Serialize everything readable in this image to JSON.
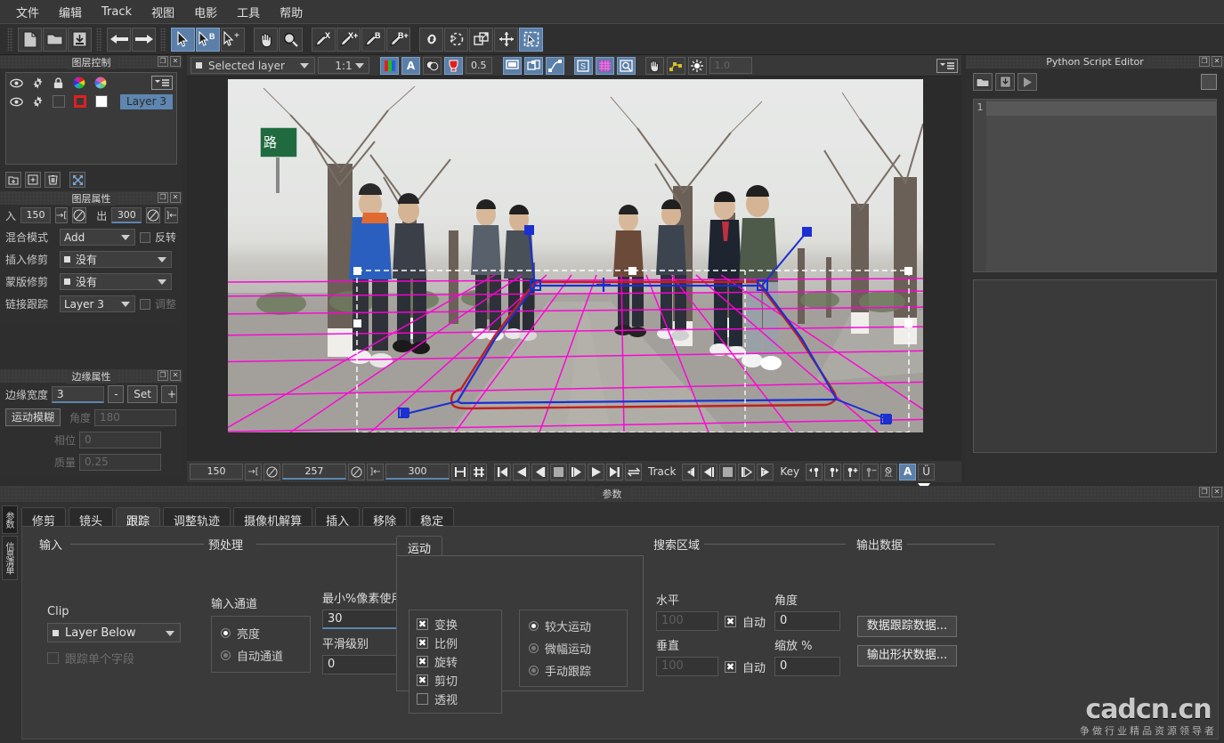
{
  "app": {
    "menu": [
      "文件",
      "编辑",
      "Track",
      "视图",
      "电影",
      "工具",
      "帮助"
    ]
  },
  "toolbar": {
    "groups": [
      [
        "new-document-icon",
        "open-folder-icon",
        "save-icon"
      ],
      [
        "arrow-left-icon",
        "arrow-right-icon"
      ],
      [
        "select-pointer-icon",
        "select-pointer-b-icon",
        "select-pointer-plus-icon"
      ],
      [
        "pan-hand-icon",
        "zoom-magnifier-icon"
      ],
      [
        "pen-x-icon",
        "pen-x-plus-icon",
        "pen-b-icon",
        "pen-b-plus-icon"
      ],
      [
        "link-icon",
        "rotate-shape-icon",
        "transform-box-icon",
        "move-cross-icon",
        "marquee-select-icon"
      ]
    ],
    "active": [
      "select-pointer-icon",
      "select-pointer-b-icon",
      "marquee-select-icon"
    ]
  },
  "layer_control": {
    "title": "图层控制",
    "header_icons": [
      "eye-icon",
      "gear-icon",
      "lock-icon",
      "color-wheel-icon",
      "color-wheel-2-icon",
      "menu-list-icon"
    ],
    "rows": [
      {
        "visible": true,
        "name": "Layer 3",
        "color": "#e02020",
        "swatch": "#ffffff"
      }
    ],
    "footer_buttons": [
      "add-layer-icon",
      "duplicate-layer-icon",
      "delete-layer-icon",
      "expand-icon"
    ]
  },
  "layer_properties": {
    "title": "图层属性",
    "in_label": "入",
    "in_value": "150",
    "out_label": "出",
    "out_value": "300",
    "blend_label": "混合模式",
    "blend_value": "Add",
    "invert_label": "反转",
    "invert_checked": false,
    "insert_matte_label": "插入修剪",
    "insert_matte_value": "没有",
    "mask_matte_label": "蒙版修剪",
    "mask_matte_value": "没有",
    "link_track_label": "链接跟踪",
    "link_track_value": "Layer 3",
    "adjust_label": "调整",
    "adjust_checked": false
  },
  "edge_properties": {
    "title": "边缘属性",
    "width_label": "边缘宽度",
    "width_value": "3",
    "minus_label": "-",
    "set_label": "Set",
    "plus_label": "+",
    "motion_blur_label": "运动模糊",
    "angle_label": "角度",
    "angle_value": "180",
    "phase_label": "相位",
    "phase_value": "0",
    "quality_label": "质量",
    "quality_value": "0.25"
  },
  "viewer": {
    "layer_select": "Selected layer",
    "zoom_select": "1:1",
    "opacity_value": "0.5",
    "gain_value": "1.0",
    "toolbar_icons": [
      "rgb-channels-icon",
      "alpha-channel-icon",
      "overlay-icon",
      "matte-color-icon",
      "monitor-icon",
      "multi-view-icon",
      "spline-icon",
      "stabilize-icon",
      "grid-icon",
      "zoom-region-icon",
      "pan-hand-icon",
      "mesh-icon",
      "brightness-icon",
      "viewer-menu-icon"
    ]
  },
  "transport": {
    "start_frame": "150",
    "current_frame": "257",
    "end_frame": "300",
    "track_label": "Track",
    "key_label": "Key",
    "buttons": [
      "go-to-start-icon",
      "play-backward-icon",
      "step-back-icon",
      "stop-icon",
      "step-forward-icon",
      "play-forward-icon",
      "go-to-end-icon",
      "loop-icon"
    ],
    "track_buttons": [
      "track-back-all-icon",
      "track-back-one-icon",
      "track-stop-icon",
      "track-forward-one-icon",
      "track-forward-all-icon"
    ],
    "key_buttons": [
      "key-prev-icon",
      "key-next-icon",
      "key-add-icon",
      "key-remove-icon",
      "key-delete-all-icon",
      "auto-key-icon",
      "key-u-icon"
    ]
  },
  "script_editor": {
    "title": "Python Script Editor",
    "buttons": [
      "open-script-icon",
      "save-script-icon",
      "run-script-icon"
    ],
    "line_numbers": [
      "1"
    ]
  },
  "params": {
    "title": "参数",
    "vertical_tabs": [
      {
        "label": "参数",
        "active": true
      },
      {
        "label": "信息清单",
        "active": false
      }
    ],
    "tabs": [
      {
        "label": "修剪",
        "active": false
      },
      {
        "label": "镜头",
        "active": false
      },
      {
        "label": "跟踪",
        "active": true
      },
      {
        "label": "调整轨迹",
        "active": false
      },
      {
        "label": "摄像机解算",
        "active": false
      },
      {
        "label": "插入",
        "active": false
      },
      {
        "label": "移除",
        "active": false
      },
      {
        "label": "稳定",
        "active": false
      }
    ],
    "input_group": {
      "title": "输入",
      "clip_label": "Clip",
      "clip_value": "Layer Below",
      "single_field_label": "跟踪单个字段",
      "single_field_checked": false
    },
    "preprocess_group": {
      "title": "预处理",
      "channel_label": "输入通道",
      "channel_options": [
        {
          "label": "亮度",
          "selected": true
        },
        {
          "label": "自动通道",
          "selected": false
        }
      ],
      "min_pixel_label": "最小%像素使用",
      "min_pixel_value": "30",
      "smooth_label": "平滑级别",
      "smooth_value": "0"
    },
    "motion_group": {
      "tab_label": "运动",
      "checkboxes": [
        {
          "label": "变换",
          "checked": true
        },
        {
          "label": "比例",
          "checked": true
        },
        {
          "label": "旋转",
          "checked": true
        },
        {
          "label": "剪切",
          "checked": true
        },
        {
          "label": "透视",
          "checked": false
        }
      ],
      "radios": [
        {
          "label": "较大运动",
          "selected": true
        },
        {
          "label": "微幅运动",
          "selected": false
        },
        {
          "label": "手动跟踪",
          "selected": false
        }
      ]
    },
    "search_group": {
      "title": "搜索区域",
      "horizontal_label": "水平",
      "horizontal_value": "100",
      "horizontal_auto_label": "自动",
      "horizontal_auto_checked": true,
      "vertical_label": "垂直",
      "vertical_value": "100",
      "vertical_auto_label": "自动",
      "vertical_auto_checked": true,
      "angle_label": "角度",
      "angle_value": "0",
      "scale_label": "缩放 %",
      "scale_value": "0"
    },
    "output_group": {
      "title": "输出数据",
      "track_data_button": "数据跟踪数据...",
      "shape_data_button": "输出形状数据..."
    }
  },
  "watermark": {
    "brand": "cadcn.cn",
    "tagline": "争做行业精品资源领导者"
  },
  "colors": {
    "accent": "#5b7fa8",
    "underline": "#5d86b0",
    "grid_magenta": "#ff00d0",
    "spline_blue": "#1a30d0",
    "spline_red": "#c02020",
    "layer_red": "#e02020",
    "timeline_red": "#b52020",
    "playhead_green": "#2fbf2f"
  }
}
